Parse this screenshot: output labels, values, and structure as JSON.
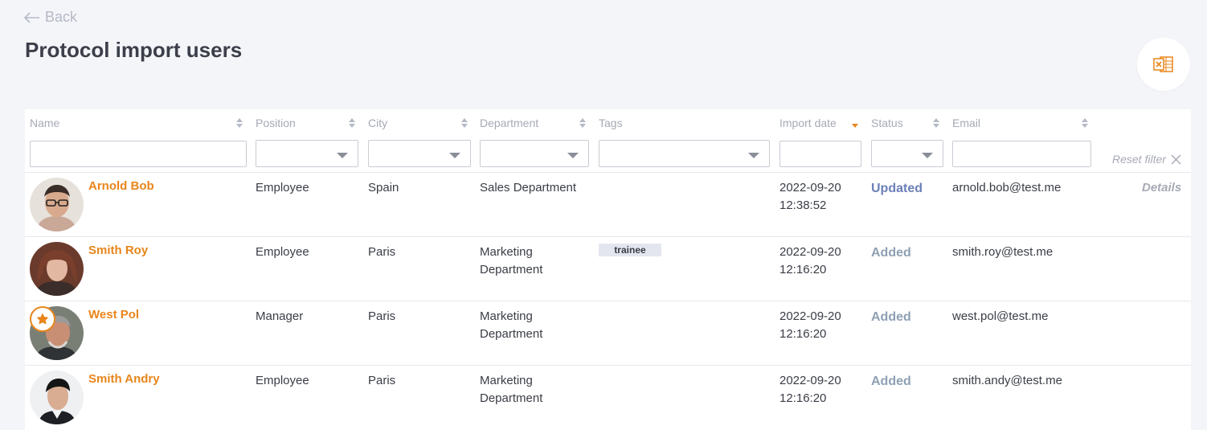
{
  "header": {
    "back_label": "Back",
    "title": "Protocol import users",
    "export_icon": "excel-icon"
  },
  "columns": [
    {
      "key": "name",
      "label": "Name"
    },
    {
      "key": "position",
      "label": "Position"
    },
    {
      "key": "city",
      "label": "City"
    },
    {
      "key": "department",
      "label": "Department"
    },
    {
      "key": "tags",
      "label": "Tags"
    },
    {
      "key": "import_date",
      "label": "Import date",
      "sorted": "desc"
    },
    {
      "key": "status",
      "label": "Status"
    },
    {
      "key": "email",
      "label": "Email"
    }
  ],
  "filters": {
    "name_value": "",
    "import_date_value": "",
    "email_value": "",
    "reset_label": "Reset filter"
  },
  "colors": {
    "accent": "#e8851b",
    "updated": "#6b7fb8",
    "added": "#8ea0b3"
  },
  "rows": [
    {
      "name": "Arnold Bob",
      "position": "Employee",
      "city": "Spain",
      "department": [
        "Sales Department"
      ],
      "tag": "",
      "date": "2022-09-20",
      "time": "12:38:52",
      "status": "Updated",
      "email": "arnold.bob@test.me",
      "details_label": "Details"
    },
    {
      "name": "Smith Roy",
      "position": "Employee",
      "city": "Paris",
      "department": [
        "Marketing",
        "Department"
      ],
      "tag": "trainee",
      "date": "2022-09-20",
      "time": "12:16:20",
      "status": "Added",
      "email": "smith.roy@test.me"
    },
    {
      "name": "West Pol",
      "position": "Manager",
      "city": "Paris",
      "department": [
        "Marketing",
        "Department"
      ],
      "tag": "",
      "date": "2022-09-20",
      "time": "12:16:20",
      "status": "Added",
      "email": "west.pol@test.me",
      "badge_icon": "star-icon"
    },
    {
      "name": "Smith Andry",
      "position": "Employee",
      "city": "Paris",
      "department": [
        "Marketing",
        "Department"
      ],
      "tag": "",
      "date": "2022-09-20",
      "time": "12:16:20",
      "status": "Added",
      "email": "smith.andy@test.me"
    }
  ]
}
